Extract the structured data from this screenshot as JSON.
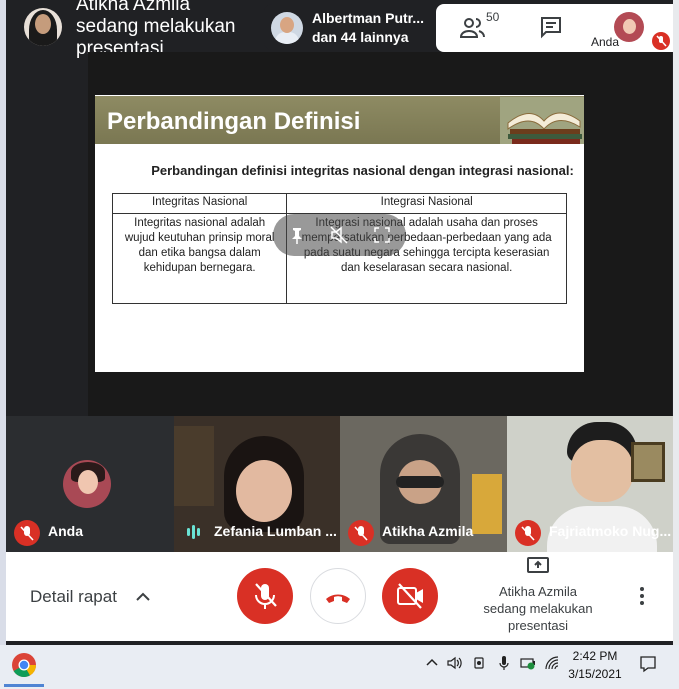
{
  "top_bar": {
    "presenter_line1": "Atikha Azmila",
    "presenter_line2": "sedang melakukan",
    "presenter_line3": "presentasi",
    "participants_chip_line1": "Albertman Putr...",
    "participants_chip_line2": "dan 44 lainnya",
    "people_count": "50",
    "self_label": "Anda",
    "people_icon": "people-icon",
    "chat_icon": "chat-icon"
  },
  "slide": {
    "title": "Perbandingan Definisi",
    "subtitle": "Perbandingan definisi integritas nasional dengan integrasi nasional:",
    "table": {
      "headers": [
        "Integritas Nasional",
        "Integrasi Nasional"
      ],
      "cells": [
        "Integritas nasional adalah wujud keutuhan prinsip moral dan etika bangsa dalam kehidupan bernegara.",
        "Integrasi nasional adalah usaha dan proses mempersatukan perbedaan-perbedaan yang ada pada suatu negara sehingga tercipta keserasian dan keselarasan secara nasional."
      ]
    }
  },
  "tiles": [
    {
      "name": "Anda",
      "mic": "muted"
    },
    {
      "name": "Zefania Lumban ...",
      "mic": "speaking"
    },
    {
      "name": "Atikha Azmila",
      "mic": "muted"
    },
    {
      "name": "Fajriatmoko Nug...",
      "mic": "muted"
    }
  ],
  "bottom_bar": {
    "details_label": "Detail rapat",
    "present_line1": "Atikha Azmila",
    "present_line2": "sedang melakukan",
    "present_line3": "presentasi",
    "mic_icon": "mic-off-icon",
    "hangup_icon": "hang-up-icon",
    "camera_icon": "camera-off-icon"
  },
  "taskbar": {
    "time": "2:42 PM",
    "date": "3/15/2021"
  },
  "colors": {
    "accent_red": "#d93025",
    "slide_header": "#8e8b63",
    "background": "#202124"
  }
}
